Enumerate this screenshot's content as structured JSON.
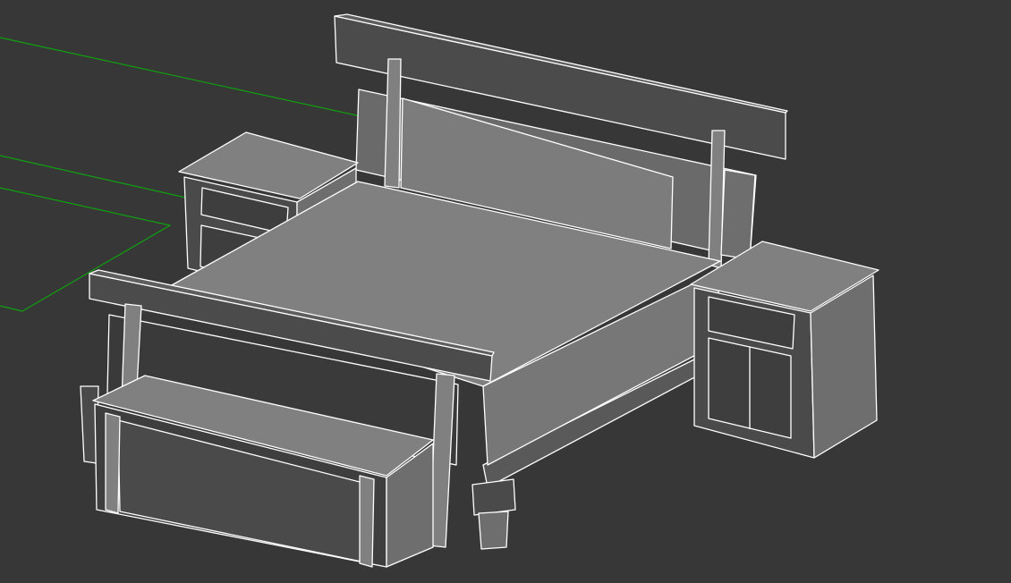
{
  "viewport": {
    "background": "#373737",
    "shading": "flat-gray-with-white-edges",
    "colors": {
      "top_face": "#808080",
      "side_face": "#6e6e6e",
      "front_face": "#3e3e3e",
      "dark_face": "#4a4a4a",
      "edge": "#ffffff",
      "ground_grid": "#0fa10f"
    }
  },
  "scene": {
    "objects": [
      "ground-grid",
      "headboard",
      "left-nightstand",
      "mattress",
      "right-nightstand",
      "footboard",
      "bench"
    ]
  }
}
